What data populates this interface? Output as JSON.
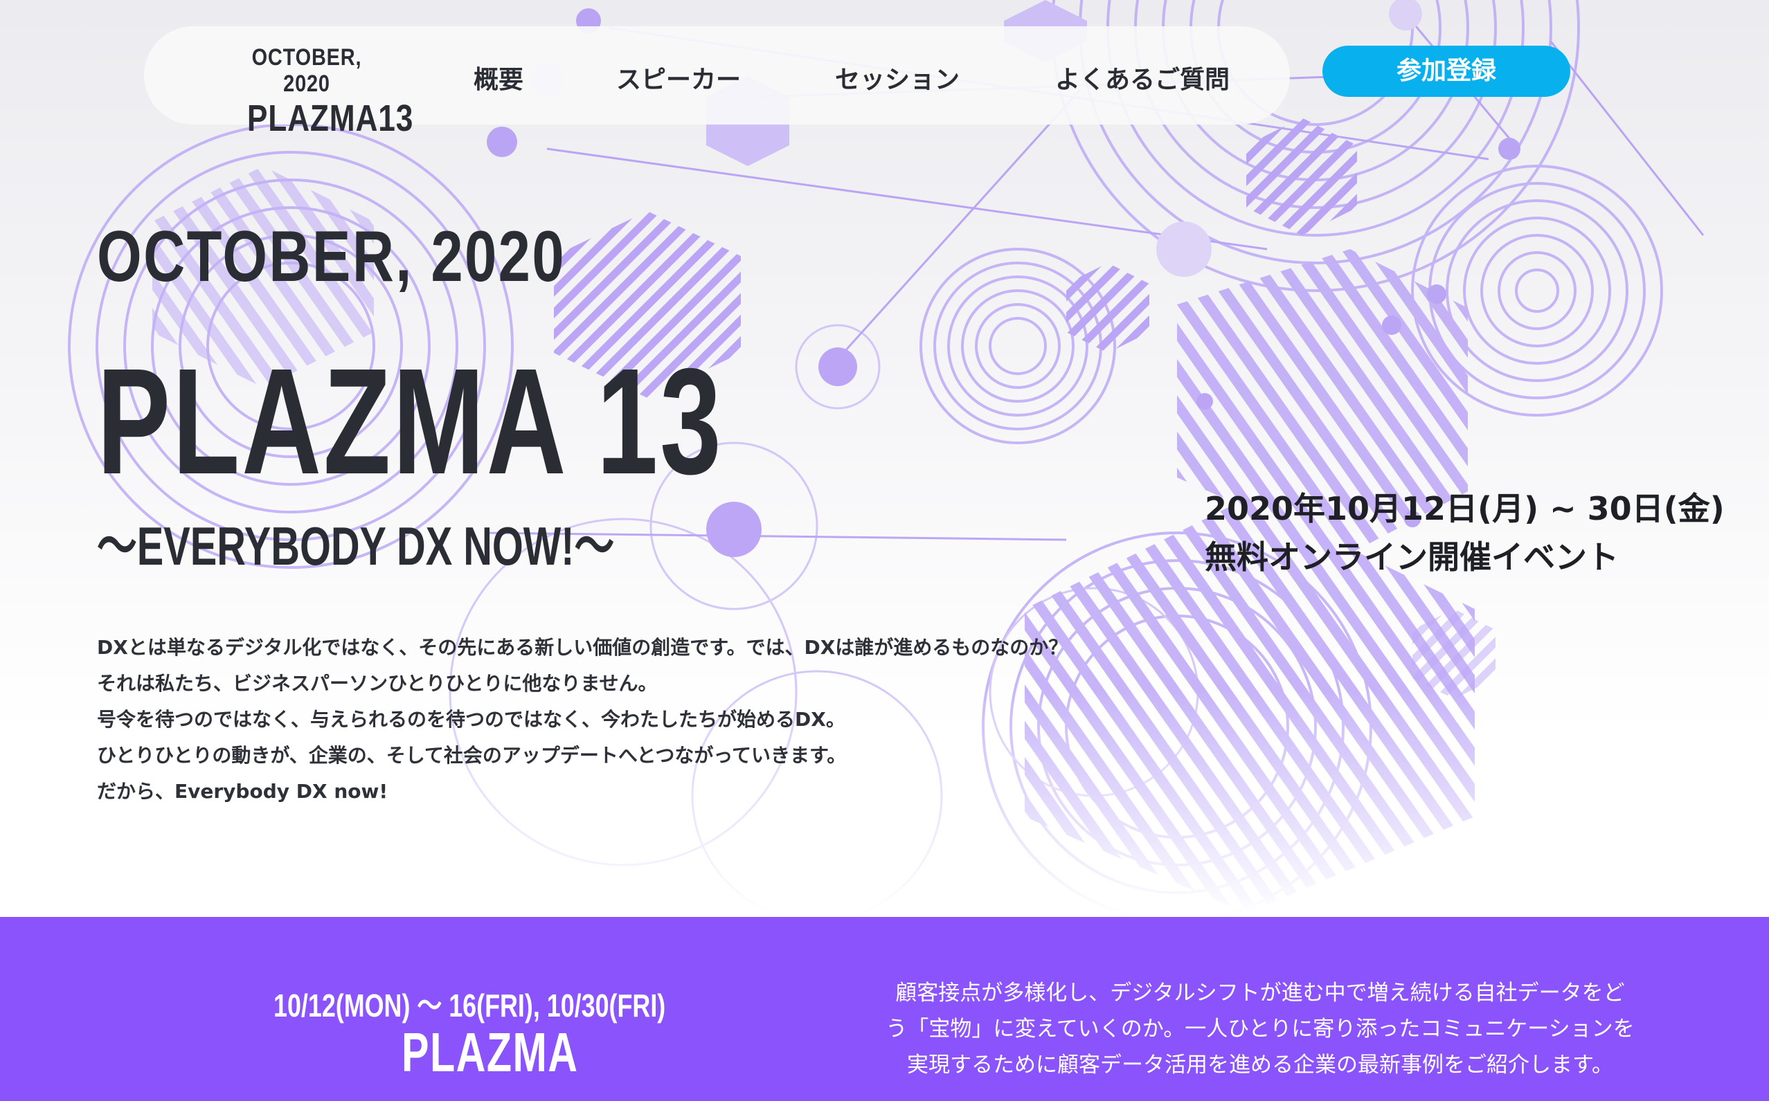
{
  "nav": {
    "logo_date": "OCTOBER, 2020",
    "logo_name": "PLAZMA13",
    "links": [
      "概要",
      "スピーカー",
      "セッション",
      "よくあるご質問"
    ],
    "register_label": "参加登録"
  },
  "hero": {
    "date": "OCTOBER, 2020",
    "title": "PLAZMA 13",
    "subtitle": "〜EVERYBODY DX NOW!〜",
    "event_date": "2020年10月12日(月) ~ 30日(金)",
    "event_type": "無料オンライン開催イベント",
    "description": [
      "DXとは単なるデジタル化ではなく、その先にある新しい価値の創造です。では、DXは誰が進めるものなのか？",
      "それは私たち、ビジネスパーソンひとりひとりに他なりません。",
      "号令を待つのではなく、与えられるのを待つのではなく、今わたしたちが始めるDX。",
      "ひとりひとりの動きが、企業の、そして社会のアップデートへとつながっていきます。",
      "だから、Everybody DX now!"
    ]
  },
  "band": {
    "date": "10/12(MON) 〜 16(FRI), 10/30(FRI)",
    "name": "PLAZMA",
    "description": [
      "顧客接点が多様化し、デジタルシフトが進む中で増え続ける自社データをど",
      "う「宝物」に変えていくのか。一人ひとりに寄り添ったコミュニケーションを",
      "実現するために顧客データ活用を進める企業の最新事例をご紹介します。"
    ]
  },
  "colors": {
    "accent_purple": "#8b53fb",
    "register_blue": "#08b0ee",
    "text_dark": "#2a2d33",
    "art_purple": "#a98bf5"
  }
}
